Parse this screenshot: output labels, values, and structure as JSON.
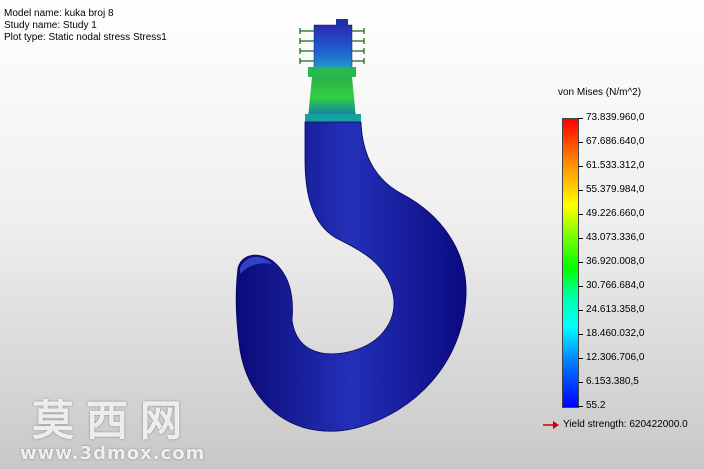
{
  "info": {
    "model_name": "Model name: kuka broj 8",
    "study_name": "Study name: Study 1",
    "plot_type": "Plot type: Static nodal stress Stress1"
  },
  "legend": {
    "title": "von Mises (N/m^2)",
    "labels": [
      "73.839.960,0",
      "67.686.640,0",
      "61.533.312,0",
      "55.379.984,0",
      "49.226.660,0",
      "43.073.336,0",
      "36.920.008,0",
      "30.766.684,0",
      "24.613.358,0",
      "18.460.032,0",
      "12.306.706,0",
      "6.153.380,5",
      "55.2"
    ],
    "yield_label": "Yield strength: 620422000.0"
  },
  "watermark": {
    "chinese": "莫西网",
    "url": "www.3dmox.com"
  },
  "colors": {
    "hook_blue": "#1a1aa0",
    "hook_highlight": "#3a48d0",
    "yield_arrow": "#cc0000"
  }
}
